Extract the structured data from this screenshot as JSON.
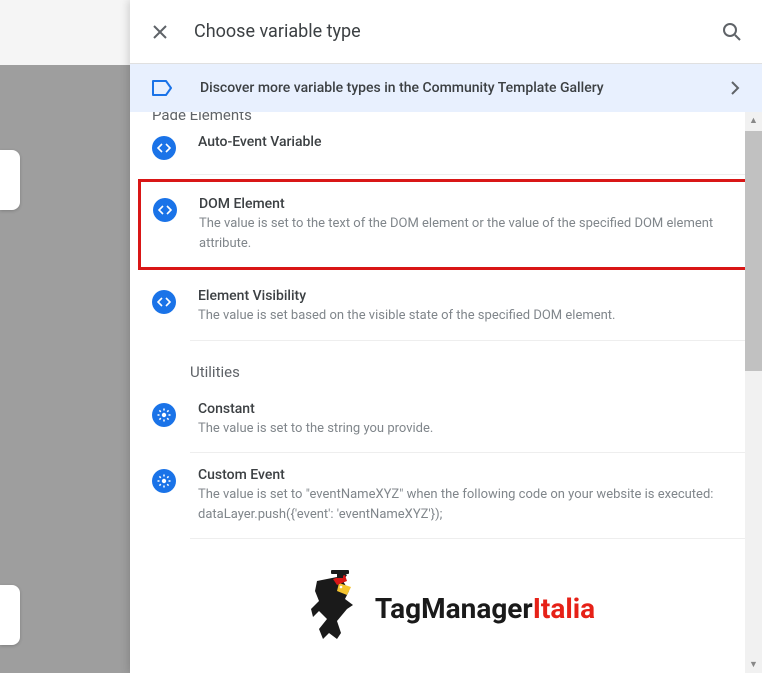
{
  "header": {
    "title": "Choose variable type"
  },
  "banner": {
    "text": "Discover more variable types in the Community Template Gallery"
  },
  "sections": {
    "page_elements": {
      "heading": "Page Elements",
      "items": {
        "auto_event": {
          "title": "Auto-Event Variable",
          "desc": ""
        },
        "dom_element": {
          "title": "DOM Element",
          "desc": "The value is set to the text of the DOM element or the value of the specified DOM element attribute."
        },
        "element_visibility": {
          "title": "Element Visibility",
          "desc": "The value is set based on the visible state of the specified DOM element."
        }
      }
    },
    "utilities": {
      "heading": "Utilities",
      "items": {
        "constant": {
          "title": "Constant",
          "desc": "The value is set to the string you provide."
        },
        "custom_event": {
          "title": "Custom Event",
          "desc": "The value is set to \"eventNameXYZ\" when the following code on your website is executed:\n dataLayer.push({'event': 'eventNameXYZ'});"
        }
      }
    }
  },
  "brand": {
    "part1": "TagManager",
    "part2": "Italia"
  }
}
